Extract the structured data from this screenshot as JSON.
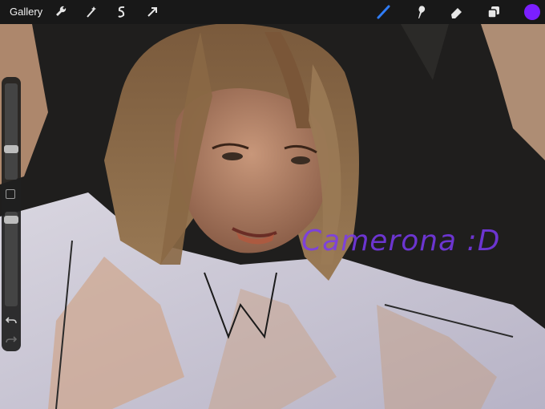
{
  "toolbar": {
    "gallery_label": "Gallery",
    "left_tools": [
      "wrench-icon",
      "magic-wand-icon",
      "selection-icon",
      "transform-icon"
    ],
    "right_tools": [
      "brush-icon",
      "smudge-icon",
      "eraser-icon",
      "layers-icon"
    ],
    "active_tool": "brush-icon",
    "accent": "#2f7cf6",
    "current_color": "#7b1fff"
  },
  "sidebar": {
    "brush_size": 0.3,
    "opacity": 0.95,
    "undo_icon": "undo-icon",
    "redo_icon": "redo-icon"
  },
  "canvas": {
    "signature": "Camerona :D"
  }
}
